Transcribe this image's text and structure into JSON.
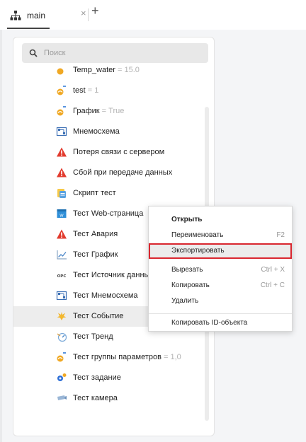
{
  "tabs": [
    {
      "label": "main",
      "close": "×"
    }
  ],
  "tab_add": "+",
  "search": {
    "placeholder": "Поиск",
    "value": ""
  },
  "list": {
    "partial_item": {
      "name": "Temp_water",
      "value": "= 15.0"
    },
    "items": [
      {
        "name": "test",
        "value": " = 1",
        "icon": "parameter-icon"
      },
      {
        "name": "График",
        "value": " = True",
        "icon": "parameter-icon"
      },
      {
        "name": "Мнемосхема",
        "value": "",
        "icon": "mnemonic-diagram-icon"
      },
      {
        "name": "Потеря связи с сервером",
        "value": "",
        "icon": "alarm-triangle-icon"
      },
      {
        "name": "Сбой при передаче данных",
        "value": "",
        "icon": "alarm-triangle-icon"
      },
      {
        "name": "Скрипт тест",
        "value": "",
        "icon": "script-icon"
      },
      {
        "name": "Тест Web-страница",
        "value": "",
        "icon": "web-page-icon"
      },
      {
        "name": "Тест Авария",
        "value": "",
        "icon": "alarm-triangle-icon"
      },
      {
        "name": "Тест График",
        "value": "",
        "icon": "chart-icon"
      },
      {
        "name": "Тест Источник данных",
        "value": "",
        "icon": "opc-data-source-icon"
      },
      {
        "name": "Тест Мнемосхема",
        "value": "",
        "icon": "mnemonic-diagram-icon"
      },
      {
        "name": "Тест Событие",
        "value": "",
        "icon": "event-icon"
      },
      {
        "name": "Тест Тренд",
        "value": "",
        "icon": "trend-icon"
      },
      {
        "name": "Тест группы параметров",
        "value": " = 1,0",
        "icon": "parameter-group-icon"
      },
      {
        "name": "Тест задание",
        "value": "",
        "icon": "task-icon"
      },
      {
        "name": "Тест камера",
        "value": "",
        "icon": "camera-icon"
      }
    ],
    "selected_index": 11
  },
  "context_menu": {
    "items": [
      {
        "label": "Открыть",
        "shortcut": "",
        "bold": true
      },
      {
        "label": "Переименовать",
        "shortcut": "F2"
      },
      {
        "label": "Экспортировать",
        "shortcut": "",
        "highlighted": true
      },
      {
        "label": "Вырезать",
        "shortcut": "Ctrl + X"
      },
      {
        "label": "Копировать",
        "shortcut": "Ctrl + C"
      },
      {
        "label": "Удалить",
        "shortcut": ""
      },
      {
        "label": "Копировать ID-объекта",
        "shortcut": ""
      }
    ]
  },
  "colors": {
    "alarm": "#e23b2e",
    "parameter": "#f0a823",
    "highlight_border": "#d9262f",
    "web_page": "#2f8fd8",
    "task": "#2e6fd6"
  }
}
